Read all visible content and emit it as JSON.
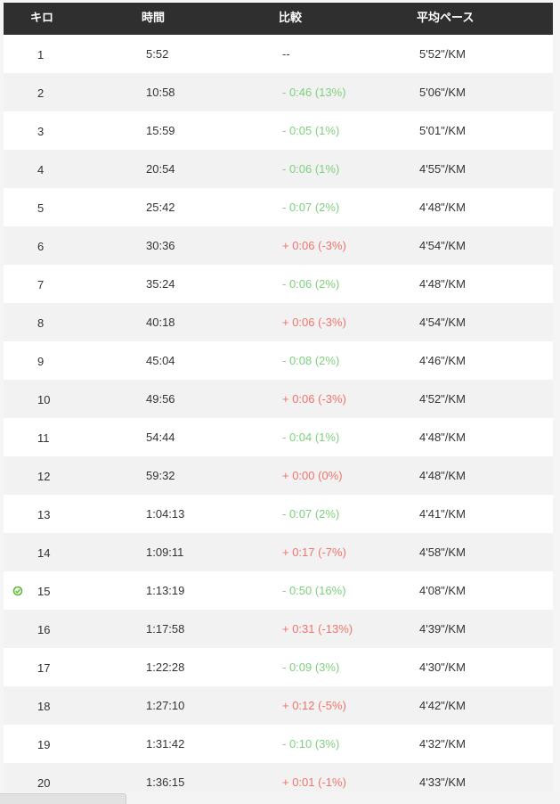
{
  "columns": {
    "km": "キロ",
    "time": "時間",
    "diff": "比較",
    "pace": "平均ペース"
  },
  "colors": {
    "header_bg": "#2f2f2f",
    "faster": "#7ed07e",
    "slower": "#f0746a",
    "marker": "#5cb82e"
  },
  "rows": [
    {
      "km": "1",
      "time": "5:52",
      "diff": "--",
      "trend": "neutral",
      "pace": "5'52\"/KM"
    },
    {
      "km": "2",
      "time": "10:58",
      "diff": "- 0:46 (13%)",
      "trend": "faster",
      "pace": "5'06\"/KM"
    },
    {
      "km": "3",
      "time": "15:59",
      "diff": "- 0:05 (1%)",
      "trend": "faster",
      "pace": "5'01\"/KM"
    },
    {
      "km": "4",
      "time": "20:54",
      "diff": "- 0:06 (1%)",
      "trend": "faster",
      "pace": "4'55\"/KM"
    },
    {
      "km": "5",
      "time": "25:42",
      "diff": "- 0:07 (2%)",
      "trend": "faster",
      "pace": "4'48\"/KM"
    },
    {
      "km": "6",
      "time": "30:36",
      "diff": "+ 0:06 (-3%)",
      "trend": "slower",
      "pace": "4'54\"/KM"
    },
    {
      "km": "7",
      "time": "35:24",
      "diff": "- 0:06 (2%)",
      "trend": "faster",
      "pace": "4'48\"/KM"
    },
    {
      "km": "8",
      "time": "40:18",
      "diff": "+ 0:06 (-3%)",
      "trend": "slower",
      "pace": "4'54\"/KM"
    },
    {
      "km": "9",
      "time": "45:04",
      "diff": "- 0:08 (2%)",
      "trend": "faster",
      "pace": "4'46\"/KM"
    },
    {
      "km": "10",
      "time": "49:56",
      "diff": "+ 0:06 (-3%)",
      "trend": "slower",
      "pace": "4'52\"/KM"
    },
    {
      "km": "11",
      "time": "54:44",
      "diff": "- 0:04 (1%)",
      "trend": "faster",
      "pace": "4'48\"/KM"
    },
    {
      "km": "12",
      "time": "59:32",
      "diff": "+ 0:00 (0%)",
      "trend": "slower",
      "pace": "4'48\"/KM"
    },
    {
      "km": "13",
      "time": "1:04:13",
      "diff": "- 0:07 (2%)",
      "trend": "faster",
      "pace": "4'41\"/KM"
    },
    {
      "km": "14",
      "time": "1:09:11",
      "diff": "+ 0:17 (-7%)",
      "trend": "slower",
      "pace": "4'58\"/KM"
    },
    {
      "km": "15",
      "time": "1:13:19",
      "diff": "- 0:50 (16%)",
      "trend": "faster",
      "pace": "4'08\"/KM",
      "marker": "fastest-lap-icon"
    },
    {
      "km": "16",
      "time": "1:17:58",
      "diff": "+ 0:31 (-13%)",
      "trend": "slower",
      "pace": "4'39\"/KM"
    },
    {
      "km": "17",
      "time": "1:22:28",
      "diff": "- 0:09 (3%)",
      "trend": "faster",
      "pace": "4'30\"/KM"
    },
    {
      "km": "18",
      "time": "1:27:10",
      "diff": "+ 0:12 (-5%)",
      "trend": "slower",
      "pace": "4'42\"/KM"
    },
    {
      "km": "19",
      "time": "1:31:42",
      "diff": "- 0:10 (3%)",
      "trend": "faster",
      "pace": "4'32\"/KM"
    },
    {
      "km": "20",
      "time": "1:36:15",
      "diff": "+ 0:01 (-1%)",
      "trend": "slower",
      "pace": "4'33\"/KM"
    }
  ]
}
